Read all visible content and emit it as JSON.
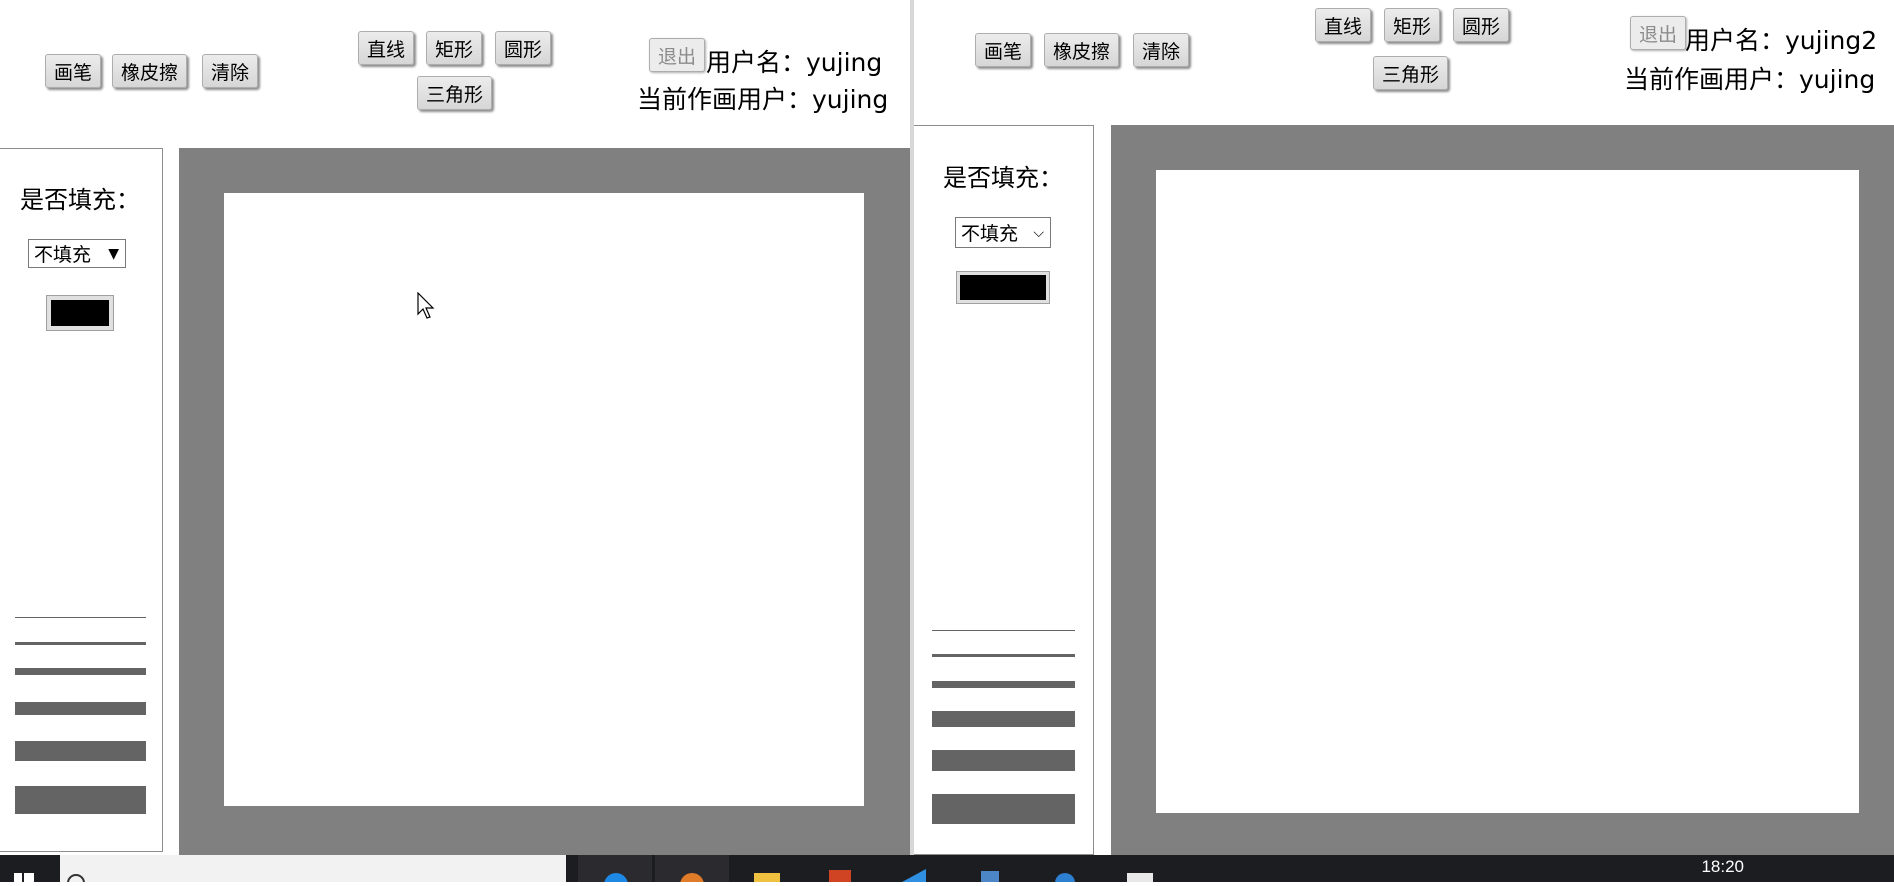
{
  "left_window": {
    "toolbar": {
      "pen_label": "画笔",
      "eraser_label": "橡皮擦",
      "clear_label": "清除",
      "line_label": "直线",
      "rect_label": "矩形",
      "circle_label": "圆形",
      "triangle_label": "三角形",
      "exit_label": "退出"
    },
    "user": {
      "username_text": "用户名：yujing",
      "current_drawer_text": "当前作画用户：yujing"
    },
    "sidebar": {
      "fill_label": "是否填充：",
      "fill_select_value": "不填充",
      "fill_select_arrow": "▼",
      "current_color": "#000000"
    }
  },
  "right_window": {
    "toolbar": {
      "pen_label": "画笔",
      "eraser_label": "橡皮擦",
      "clear_label": "清除",
      "line_label": "直线",
      "rect_label": "矩形",
      "circle_label": "圆形",
      "triangle_label": "三角形",
      "exit_label": "退出"
    },
    "user": {
      "username_text": "用户名：yujing2",
      "current_drawer_text": "当前作画用户：yujing"
    },
    "sidebar": {
      "fill_label": "是否填充：",
      "fill_select_value": "不填充",
      "fill_select_arrow": "⌵",
      "current_color": "#000000"
    }
  },
  "taskbar": {
    "clock": "18:20",
    "icons": [
      "windows-start-icon",
      "search-box",
      "edge-icon",
      "browser-icon",
      "file-explorer-icon",
      "office-icon",
      "vscode-icon",
      "app-icon",
      "app-icon",
      "app-icon"
    ]
  },
  "colors": {
    "canvas_border": "#808080",
    "line_option": "#646464",
    "taskbar": "#1c1d20"
  }
}
